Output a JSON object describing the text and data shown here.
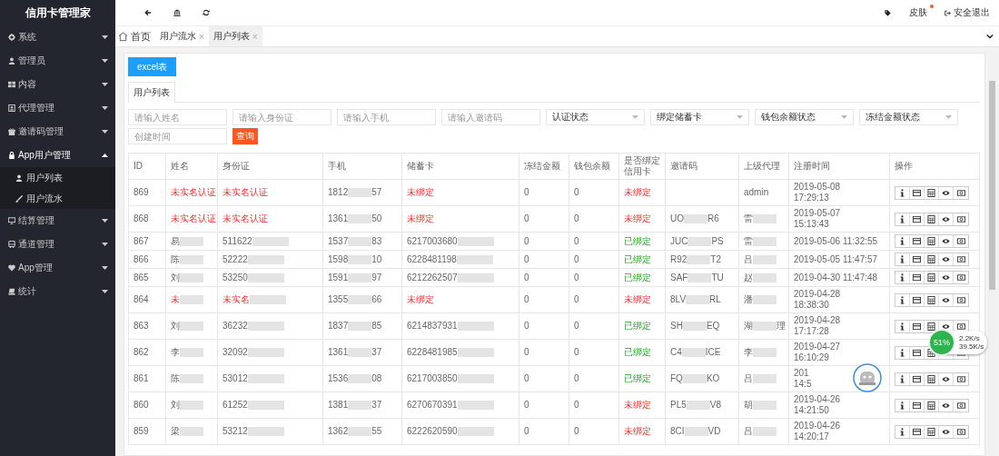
{
  "sidebar": {
    "title": "信用卡管理家",
    "items": [
      {
        "label": "系统",
        "expanded": false
      },
      {
        "label": "管理员",
        "expanded": false
      },
      {
        "label": "内容",
        "expanded": false
      },
      {
        "label": "代理管理",
        "expanded": false
      },
      {
        "label": "邀请码管理",
        "expanded": false
      },
      {
        "label": "App用户管理",
        "expanded": true,
        "children": [
          {
            "label": "用户列表"
          },
          {
            "label": "用户流水"
          }
        ]
      },
      {
        "label": "结算管理",
        "expanded": false
      },
      {
        "label": "通道管理",
        "expanded": false
      },
      {
        "label": "App管理",
        "expanded": false
      },
      {
        "label": "统计",
        "expanded": false
      }
    ]
  },
  "topbar": {
    "skin": "皮肤",
    "logout": "安全退出"
  },
  "tabs": [
    {
      "label": "首页",
      "kind": "home",
      "selected": false
    },
    {
      "label": "用户流水",
      "kind": "closable",
      "close": "×",
      "selected": false
    },
    {
      "label": "用户列表",
      "kind": "closable",
      "close": "×",
      "selected": true
    }
  ],
  "export_button": "excel表",
  "sub_tabs": [
    {
      "label": "用户列表",
      "selected": true
    }
  ],
  "filters": [
    {
      "kind": "input",
      "placeholder": "请输入姓名"
    },
    {
      "kind": "input",
      "placeholder": "请输入身份证"
    },
    {
      "kind": "input",
      "placeholder": "请输入手机"
    },
    {
      "kind": "input",
      "placeholder": "请输入邀请码"
    },
    {
      "kind": "select",
      "value": "认证状态"
    },
    {
      "kind": "select",
      "value": "绑定储蓄卡"
    },
    {
      "kind": "select",
      "value": "钱包余额状态"
    },
    {
      "kind": "select",
      "value": "冻结金额状态"
    },
    {
      "kind": "input",
      "placeholder": "创建时间"
    },
    {
      "kind": "button",
      "label": "查询"
    }
  ],
  "table": {
    "columns": [
      "ID",
      "姓名",
      "身份证",
      "手机",
      "储蓄卡",
      "冻结金额",
      "钱包余额",
      "是否绑定信用卡",
      "邀请码",
      "上级代理",
      "注册时间",
      "操作"
    ],
    "rows": [
      {
        "id": "869",
        "verified": false,
        "name": "未实名认证",
        "id_card": "未实名认证",
        "phone": {
          "text": "1812",
          "redacted": true,
          "end": "57"
        },
        "card_bound": false,
        "card": "未绑定",
        "frozen": "0",
        "wallet": "0",
        "credit_bound": false,
        "credit": "未绑定",
        "agent": "admin",
        "time": [
          "2019-05-08",
          "17:29:13"
        ]
      },
      {
        "id": "868",
        "verified": false,
        "name": "未实名认证",
        "id_card": "未实名认证",
        "phone": {
          "text": "1361",
          "redacted": true,
          "end": "50"
        },
        "card_bound": false,
        "card": "未绑定",
        "frozen": "0",
        "wallet": "0",
        "credit_bound": false,
        "credit": "未绑定",
        "invite": {
          "text": "UO",
          "redacted": true,
          "end": "R6"
        },
        "agent": {
          "text": "雷",
          "redacted": true
        },
        "time": [
          "2019-05-07",
          "15:13:43"
        ]
      },
      {
        "id": "867",
        "verified": true,
        "name": {
          "text": "易",
          "redacted": true
        },
        "id_card": {
          "text": "511622",
          "redacted": true
        },
        "phone": {
          "text": "1537",
          "redacted": true,
          "end": "83"
        },
        "card_bound": true,
        "card": {
          "text": "6217003680",
          "redacted": true
        },
        "frozen": "0",
        "wallet": "0",
        "credit_bound": true,
        "credit": "已绑定",
        "invite": {
          "text": "JUC",
          "redacted": true,
          "end": "PS"
        },
        "agent": {
          "text": "雷",
          "redacted": true
        },
        "time": "2019-05-06 11:32:55"
      },
      {
        "id": "866",
        "verified": true,
        "name": {
          "text": "陈",
          "redacted": true
        },
        "id_card": {
          "text": "52222",
          "redacted": true
        },
        "phone": {
          "text": "1598",
          "redacted": true,
          "end": "10"
        },
        "card_bound": true,
        "card": {
          "text": "6228481198",
          "redacted": true
        },
        "frozen": "0",
        "wallet": "0",
        "credit_bound": true,
        "credit": "已绑定",
        "invite": {
          "text": "R92",
          "redacted": true,
          "end": "T2"
        },
        "agent": {
          "text": "吕",
          "redacted": true
        },
        "time": "2019-05-05 11:47:57"
      },
      {
        "id": "865",
        "verified": true,
        "name": {
          "text": "刘",
          "redacted": true
        },
        "id_card": {
          "text": "53250",
          "redacted": true
        },
        "phone": {
          "text": "1591",
          "redacted": true,
          "end": "97"
        },
        "card_bound": true,
        "card": {
          "text": "6212262507",
          "redacted": true
        },
        "frozen": "0",
        "wallet": "0",
        "credit_bound": true,
        "credit": "已绑定",
        "invite": {
          "text": "SAF",
          "redacted": true,
          "end": "TU"
        },
        "agent": {
          "text": "赵",
          "redacted": true
        },
        "time": "2019-04-30 11:47:48"
      },
      {
        "id": "864",
        "verified": false,
        "name": {
          "text": "未",
          "redacted": true
        },
        "id_card": {
          "text": "未实名",
          "redacted": true
        },
        "phone": {
          "text": "1355",
          "redacted": true,
          "end": "66"
        },
        "card_bound": false,
        "card": "未绑定",
        "frozen": "0",
        "wallet": "0",
        "credit_bound": false,
        "credit": "未绑定",
        "invite": {
          "text": "8LV",
          "redacted": true,
          "end": "RL"
        },
        "agent": {
          "text": "潘",
          "redacted": true
        },
        "time": [
          "2019-04-28",
          "18:38:30"
        ]
      },
      {
        "id": "863",
        "verified": true,
        "name": {
          "text": "刘",
          "redacted": true
        },
        "id_card": {
          "text": "36232",
          "redacted": true
        },
        "phone": {
          "text": "1837",
          "redacted": true,
          "end": "85"
        },
        "card_bound": true,
        "card": {
          "text": "6214837931",
          "redacted": true
        },
        "frozen": "0",
        "wallet": "0",
        "credit_bound": true,
        "credit": "已绑定",
        "invite": {
          "text": "SH",
          "redacted": true,
          "end": "EQ"
        },
        "agent": {
          "text": "湖",
          "redacted": true,
          "end": "理"
        },
        "time": [
          "2019-04-28",
          "17:17:28"
        ]
      },
      {
        "id": "862",
        "verified": true,
        "name": {
          "text": "李",
          "redacted": true
        },
        "id_card": {
          "text": "32092",
          "redacted": true
        },
        "phone": {
          "text": "1361",
          "redacted": true,
          "end": "37"
        },
        "card_bound": true,
        "card": {
          "text": "6228481985",
          "redacted": true
        },
        "frozen": "0",
        "wallet": "0",
        "credit_bound": true,
        "credit": "已绑定",
        "invite": {
          "text": "C4",
          "redacted": true,
          "end": "ICE"
        },
        "agent": {
          "text": "李",
          "redacted": true
        },
        "time": [
          "2019-04-27",
          "16:10:29"
        ]
      },
      {
        "id": "861",
        "verified": true,
        "name": {
          "text": "陈",
          "redacted": true
        },
        "id_card": {
          "text": "53012",
          "redacted": true
        },
        "phone": {
          "text": "1536",
          "redacted": true,
          "end": "08"
        },
        "card_bound": true,
        "card": {
          "text": "6217003850",
          "redacted": true
        },
        "frozen": "0",
        "wallet": "0",
        "credit_bound": true,
        "credit": "已绑定",
        "invite": {
          "text": "FQ",
          "redacted": true,
          "end": "KO"
        },
        "agent": {
          "text": "吕",
          "redacted": true
        },
        "time": [
          "201",
          "14:5"
        ]
      },
      {
        "id": "860",
        "verified": true,
        "name": {
          "text": "刘",
          "redacted": true
        },
        "id_card": {
          "text": "61252",
          "redacted": true
        },
        "phone": {
          "text": "1381",
          "redacted": true,
          "end": "37"
        },
        "card_bound": true,
        "card": {
          "text": "6270670391",
          "redacted": true
        },
        "frozen": "0",
        "wallet": "0",
        "credit_bound": false,
        "credit": "未绑定",
        "invite": {
          "text": "PL5",
          "redacted": true,
          "end": "V8"
        },
        "agent": {
          "text": "胡",
          "redacted": true
        },
        "time": [
          "2019-04-26",
          "14:21:50"
        ]
      },
      {
        "id": "859",
        "verified": true,
        "name": {
          "text": "梁",
          "redacted": true
        },
        "id_card": {
          "text": "53212",
          "redacted": true
        },
        "phone": {
          "text": "1362",
          "redacted": true,
          "end": "55"
        },
        "card_bound": true,
        "card": {
          "text": "6222620590",
          "redacted": true
        },
        "frozen": "0",
        "wallet": "0",
        "credit_bound": false,
        "credit": "未绑定",
        "invite": {
          "text": "8CI",
          "redacted": true,
          "end": "VD"
        },
        "agent": {
          "text": "吕",
          "redacted": true
        },
        "time": [
          "2019-04-26",
          "14:20:17"
        ]
      }
    ]
  },
  "speed_widget": {
    "percent": "51%",
    "upload": "2.2K/s",
    "download": "39.5K/s"
  }
}
